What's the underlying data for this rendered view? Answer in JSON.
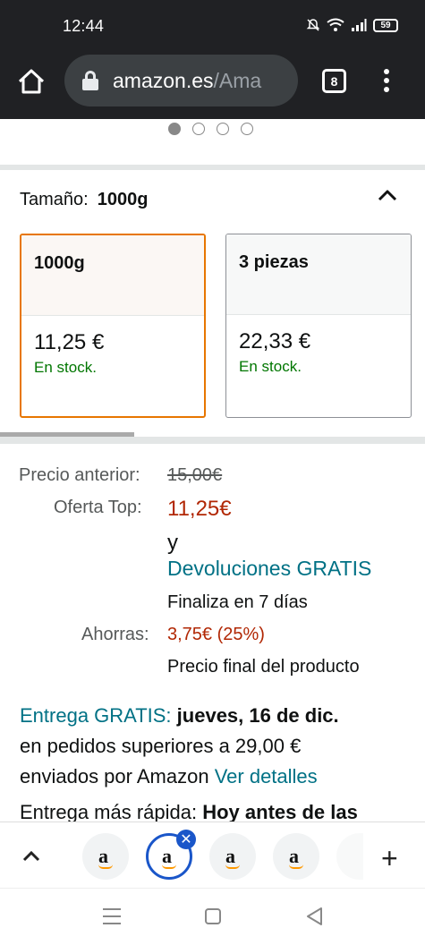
{
  "status_bar": {
    "time": "12:44",
    "battery": "59"
  },
  "browser": {
    "url_domain": "amazon.es",
    "url_path": "/Ama",
    "tab_count": "8"
  },
  "carousel": {
    "total": 4,
    "active": 0
  },
  "size": {
    "label": "Tamaño:",
    "value": "1000g",
    "options": [
      {
        "name": "1000g",
        "price": "11,25 €",
        "stock": "En stock."
      },
      {
        "name": "3 piezas",
        "price": "22,33 €",
        "stock": "En stock."
      }
    ]
  },
  "pricing": {
    "prev_label": "Precio anterior:",
    "prev_value": "15,00€",
    "deal_label": "Oferta Top:",
    "deal_value": "11,25€",
    "and": "y",
    "returns": "Devoluciones GRATIS",
    "ends": "Finaliza en 7 días",
    "save_label": "Ahorras:",
    "save_value": "3,75€ (25%)",
    "final_note": "Precio final del producto"
  },
  "delivery": {
    "free": "Entrega GRATIS:",
    "date": "jueves, 16 de dic.",
    "line2": "en pedidos superiores a 29,00 €",
    "line3_a": "enviados por Amazon",
    "details_link": "Ver detalles",
    "faster_a": "Entrega más rápida:",
    "faster_b": "Hoy antes de las"
  },
  "tabstrip": {
    "tab_letter": "a",
    "plus": "+"
  }
}
